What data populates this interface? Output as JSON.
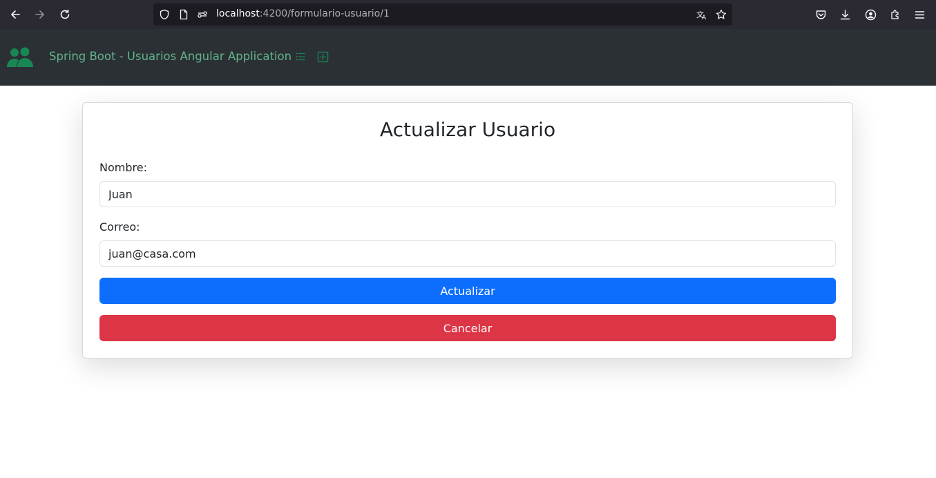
{
  "browser": {
    "url_host": "localhost",
    "url_path": ":4200/formulario-usuario/1"
  },
  "navbar": {
    "brand": "Spring Boot - Usuarios Angular Application",
    "brand_color": "#63b48a",
    "links": [
      {
        "icon": "list-icon"
      },
      {
        "icon": "plus-square-icon"
      }
    ]
  },
  "form": {
    "title": "Actualizar Usuario",
    "nombre_label": "Nombre:",
    "nombre_value": "Juan",
    "correo_label": "Correo:",
    "correo_value": "juan@casa.com",
    "submit_label": "Actualizar",
    "cancel_label": "Cancelar",
    "submit_color": "#0d6efd",
    "cancel_color": "#dc3545"
  }
}
